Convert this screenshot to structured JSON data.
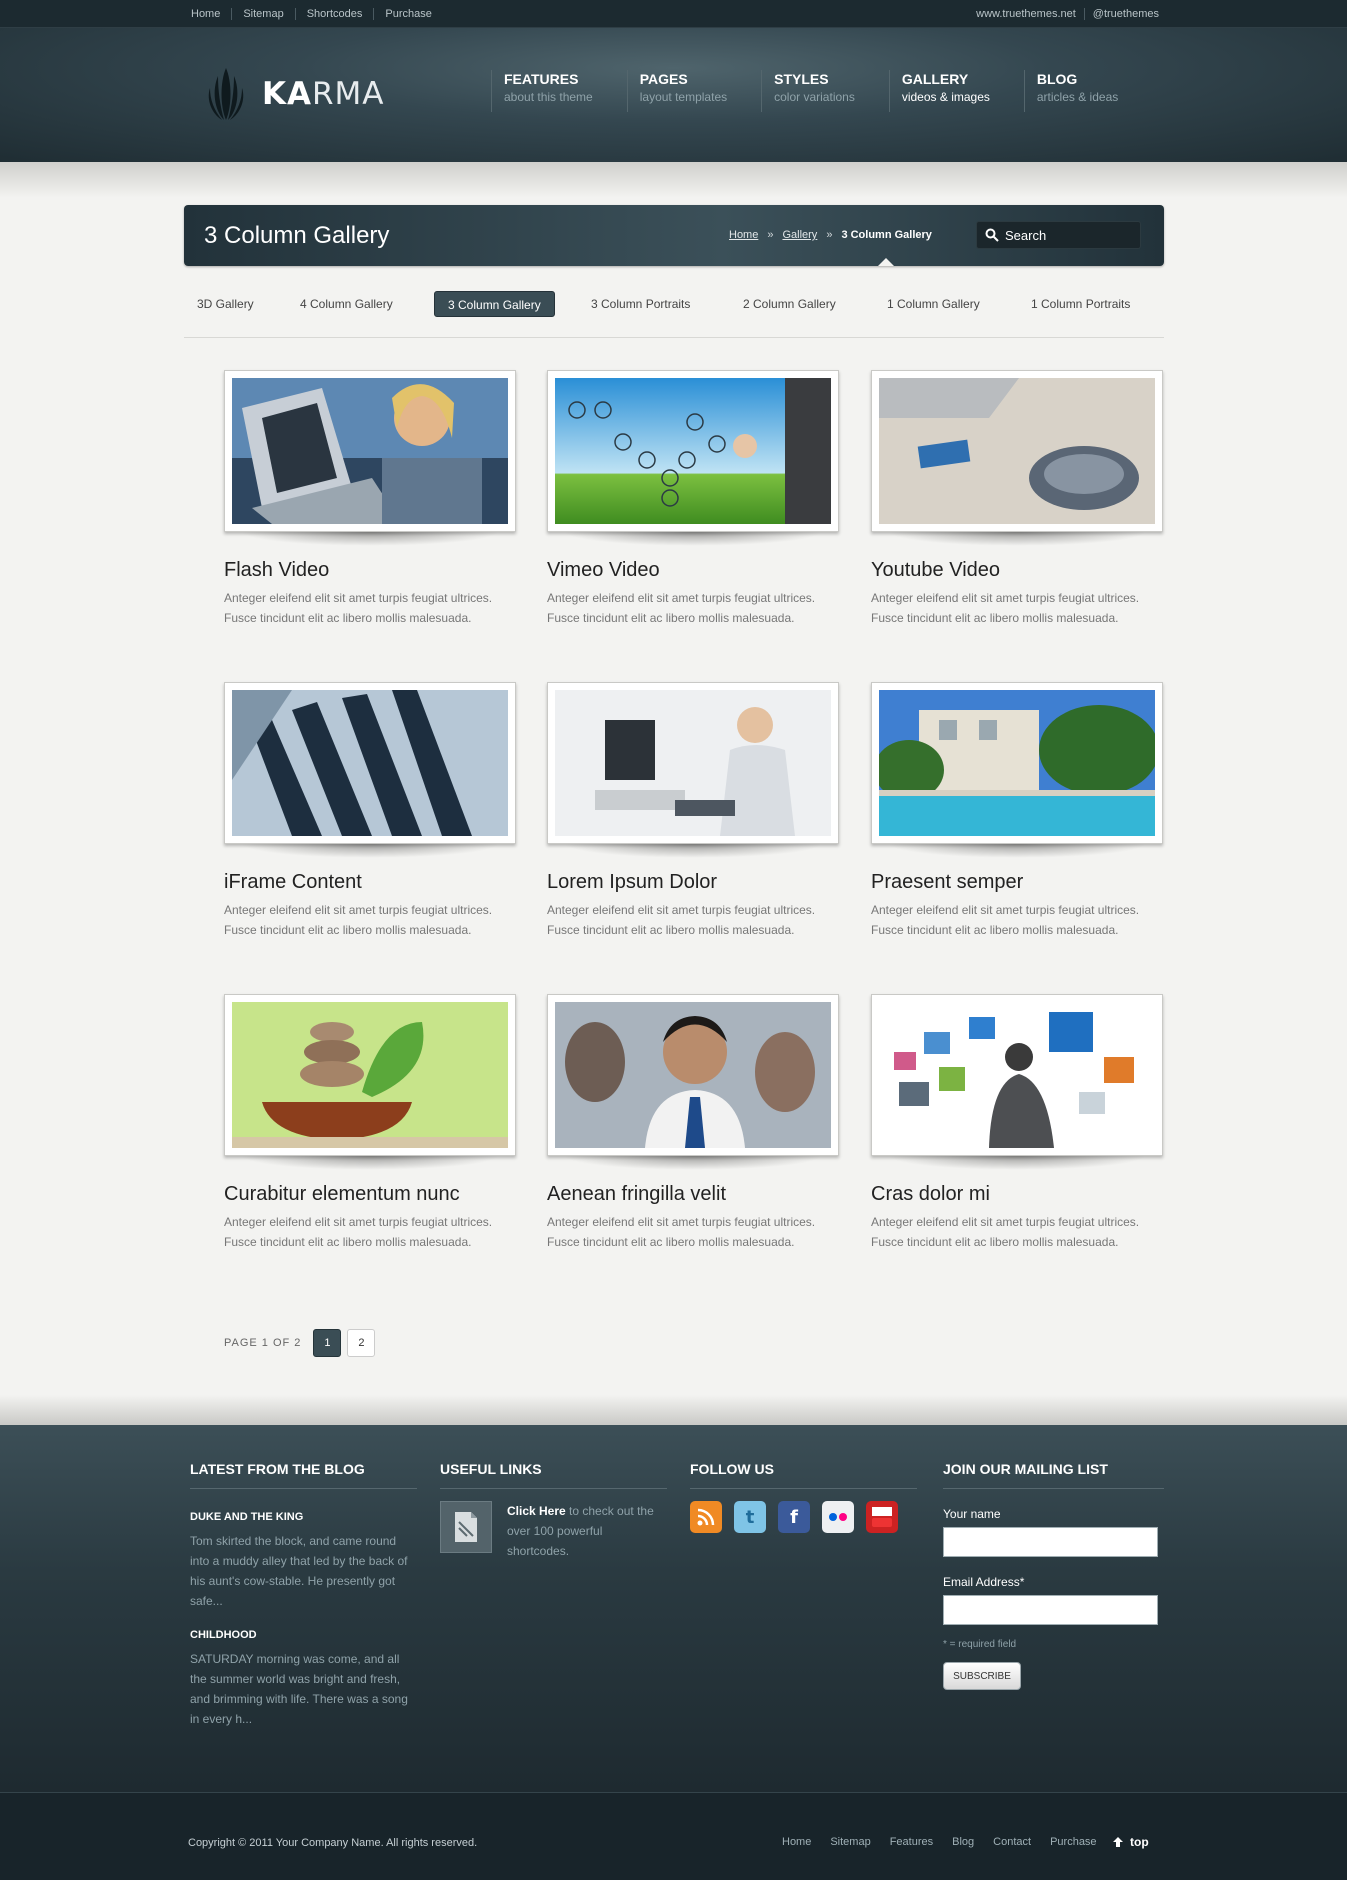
{
  "topbar": {
    "links": [
      "Home",
      "Sitemap",
      "Shortcodes",
      "Purchase"
    ],
    "right": [
      "www.truethemes.net",
      "@truethemes"
    ]
  },
  "logo": {
    "bold": "KA",
    "rest": "RMA"
  },
  "nav": [
    {
      "title": "FEATURES",
      "sub": "about this theme"
    },
    {
      "title": "PAGES",
      "sub": "layout templates"
    },
    {
      "title": "STYLES",
      "sub": "color variations"
    },
    {
      "title": "GALLERY",
      "sub": "videos & images"
    },
    {
      "title": "BLOG",
      "sub": "articles & ideas"
    }
  ],
  "page": {
    "title": "3 Column Gallery",
    "breadcrumb": {
      "home": "Home",
      "sep1": "»",
      "gallery": "Gallery",
      "sep2": "»",
      "current": "3 Column Gallery"
    },
    "search_placeholder": "Search"
  },
  "tabs": [
    "3D Gallery",
    "4 Column Gallery",
    "3 Column Gallery",
    "3 Column Portraits",
    "2 Column Gallery",
    "1 Column Gallery",
    "1 Column Portraits"
  ],
  "gallery": [
    {
      "title": "Flash Video",
      "line1": "Anteger eleifend elit sit amet turpis feugiat ultrices.",
      "line2": "Fusce tincidunt elit ac libero mollis malesuada."
    },
    {
      "title": "Vimeo Video",
      "line1": "Anteger eleifend elit sit amet turpis feugiat ultrices.",
      "line2": "Fusce tincidunt elit ac libero mollis malesuada."
    },
    {
      "title": "Youtube Video",
      "line1": "Anteger eleifend elit sit amet turpis feugiat ultrices.",
      "line2": "Fusce tincidunt elit ac libero mollis malesuada."
    },
    {
      "title": "iFrame Content",
      "line1": "Anteger eleifend elit sit amet turpis feugiat ultrices.",
      "line2": "Fusce tincidunt elit ac libero mollis malesuada."
    },
    {
      "title": "Lorem Ipsum Dolor",
      "line1": "Anteger eleifend elit sit amet turpis feugiat ultrices.",
      "line2": "Fusce tincidunt elit ac libero mollis malesuada."
    },
    {
      "title": "Praesent semper",
      "line1": "Anteger eleifend elit sit amet turpis feugiat ultrices.",
      "line2": "Fusce tincidunt elit ac libero mollis malesuada."
    },
    {
      "title": "Curabitur elementum nunc",
      "line1": "Anteger eleifend elit sit amet turpis feugiat ultrices.",
      "line2": "Fusce tincidunt elit ac libero mollis malesuada."
    },
    {
      "title": "Aenean fringilla velit",
      "line1": "Anteger eleifend elit sit amet turpis feugiat ultrices.",
      "line2": "Fusce tincidunt elit ac libero mollis malesuada."
    },
    {
      "title": "Cras dolor mi",
      "line1": "Anteger eleifend elit sit amet turpis feugiat ultrices.",
      "line2": "Fusce tincidunt elit ac libero mollis malesuada."
    }
  ],
  "pager": {
    "label": "PAGE 1 OF 2",
    "pages": [
      "1",
      "2"
    ]
  },
  "footer": {
    "blog": {
      "heading": "LATEST FROM THE BLOG",
      "posts": [
        {
          "title": "DUKE AND THE KING",
          "text": "Tom skirted the block, and came round into a muddy alley that led by the back of his aunt's cow-stable. He presently got safe..."
        },
        {
          "title": "CHILDHOOD",
          "text": "SATURDAY morning was come, and all the summer world was bright and fresh, and brimming with life. There was a song in every h..."
        }
      ]
    },
    "links": {
      "heading": "USEFUL LINKS",
      "bold": "Click Here",
      "text": " to check out the over 100 powerful shortcodes."
    },
    "follow": {
      "heading": "FOLLOW US",
      "icons": [
        "rss-icon",
        "twitter-icon",
        "facebook-icon",
        "flickr-icon",
        "youtube-icon"
      ]
    },
    "mailing": {
      "heading": "JOIN OUR MAILING LIST",
      "name_label": "Your name",
      "email_label": "Email Address*",
      "required": "* = required field",
      "button": "SUBSCRIBE"
    }
  },
  "bottom": {
    "copyright": "Copyright © 2011 Your Company Name. All rights reserved.",
    "links": [
      "Home",
      "Sitemap",
      "Features",
      "Blog",
      "Contact",
      "Purchase"
    ],
    "top": "top"
  }
}
